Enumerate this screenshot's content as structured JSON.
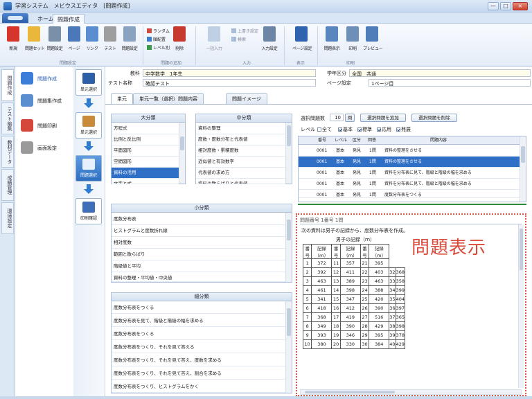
{
  "window": {
    "title": "学習システム　メビウスエディタ　[問題作成]",
    "buttons": [
      "—",
      "□",
      "×"
    ]
  },
  "ribbon": {
    "tabs": [
      "ホーム",
      "問題作成"
    ],
    "active_tab": "問題作成",
    "buttons": [
      {
        "label": "新規",
        "icon": "new-doc-icon",
        "color": "#d6352b"
      },
      {
        "label": "問題セット",
        "icon": "folder-icon",
        "color": "#e8b73c"
      },
      {
        "label": "問題設定",
        "icon": "settings-doc-icon",
        "color": "#7a8fa8"
      },
      {
        "label": "ページ",
        "icon": "page-icon",
        "color": "#4a78b8"
      },
      {
        "label": "リンク",
        "icon": "link-icon",
        "color": "#5a8ed0"
      },
      {
        "label": "テスト",
        "icon": "test-icon",
        "color": "#9e9e9e"
      },
      {
        "label": "問題設定",
        "icon": "settings-icon",
        "color": "#8aa3c0"
      }
    ],
    "random": {
      "label1": "ランダム",
      "label2": "順配置",
      "label3": "レベル別",
      "extra": "削除"
    },
    "center_buttons": [
      "一括入力",
      "全問選択",
      "入力設定",
      "ページ設定",
      "問題表示",
      "印刷",
      "プレビュー"
    ],
    "edit_small": [
      "上書き設定",
      "検索"
    ],
    "groups": [
      "問題設定",
      "問題の追加",
      "入力",
      "表示",
      "印刷"
    ]
  },
  "left_tabs": [
    "問題作成",
    "テスト編集",
    "教材データ",
    "成績管理",
    "環境設定"
  ],
  "nav": [
    {
      "label": "問題作成",
      "icon": "question-create-icon",
      "color": "#3b7dd8",
      "active": true
    },
    {
      "label": "問題集作成",
      "icon": "workbook-icon",
      "color": "#5b8ecf",
      "active": false
    },
    {
      "label": "問題印刷",
      "icon": "print-icon",
      "color": "#d5473a",
      "active": false
    },
    {
      "label": "画面設定",
      "icon": "screen-icon",
      "color": "#9a9a9a",
      "active": false
    }
  ],
  "flow": [
    {
      "label": "単元選択",
      "icon": "unit-icon",
      "active": false
    },
    {
      "label": "単元選択",
      "icon": "person-icon",
      "active": false
    },
    {
      "label": "問題選択",
      "icon": "select-icon",
      "active": true
    },
    {
      "label": "印刷確認",
      "icon": "check-icon",
      "active": false
    }
  ],
  "header": {
    "subject_label": "教科",
    "subject_value": "中学数学　1年生",
    "grade_label": "学年区分",
    "grade_value": "全国　共通",
    "test_label": "テスト名称",
    "test_value": "確認テスト",
    "page_label": "ページ設定",
    "page_value": "1ページ目"
  },
  "tabs": [
    "単元",
    "単元一覧（選択）問題内容",
    "問題イメージ"
  ],
  "big_unit": {
    "title": "大分類",
    "items": [
      "方程式",
      "比例と反比例",
      "平面図形",
      "空間図形",
      "資料の活用",
      "文字と式"
    ],
    "selected": 4
  },
  "mid_unit": {
    "title": "中分類",
    "items": [
      "資料の整理",
      "度数・度数分布と代表値",
      "相対度数・累積度数",
      "近似値と有効数字",
      "代表値の求め方",
      "資料の散らばりと代表値"
    ],
    "selected": -1
  },
  "small_unit": {
    "title": "小分類",
    "items": [
      "度数分布表",
      "ヒストグラムと度数折れ線",
      "相対度数",
      "範囲と散らばり",
      "階級値と平均",
      "資料の整理・平均値・中央値"
    ]
  },
  "detail_unit": {
    "title": "細分類",
    "items": [
      "度数分布表をつくる",
      "度数分布表を見て、階級と階級の幅を求める",
      "度数分布表をつくる",
      "度数分布表をつくり、それを見て答える",
      "度数分布表をつくり、それを見て答え、度数を求める",
      "度数分布表をつくり、それを見て答え、割合を求める",
      "度数分布表をつくり、ヒストグラムをかく"
    ]
  },
  "question_list": {
    "count_label": "選択問題数",
    "count_value": "10",
    "unit": "問",
    "add_button": "選択問題を追加",
    "clear_button": "選択問題を削除",
    "level_label": "レベル",
    "filters": [
      {
        "label": "全て",
        "on": false
      },
      {
        "label": "基本",
        "on": true
      },
      {
        "label": "標準",
        "on": true
      },
      {
        "label": "応用",
        "on": true
      },
      {
        "label": "発展",
        "on": true
      }
    ],
    "columns": [
      "",
      "番号",
      "レベル",
      "区分",
      "回答",
      "問題内容"
    ],
    "rows": [
      {
        "no": "0001",
        "level": "基本",
        "kind": "発見",
        "ans": "1問",
        "text": "資料の整理をさせる",
        "sel": false
      },
      {
        "no": "0001",
        "level": "基本",
        "kind": "発見",
        "ans": "1問",
        "text": "資料の整理をさせる",
        "sel": true
      },
      {
        "no": "0001",
        "level": "基本",
        "kind": "発見",
        "ans": "1問",
        "text": "資料を分布表に見て、階級と階級の幅を求める",
        "sel": false
      },
      {
        "no": "0001",
        "level": "基本",
        "kind": "発見",
        "ans": "1問",
        "text": "資料を分布表に見て、階級と階級の幅を求める",
        "sel": false
      },
      {
        "no": "0001",
        "level": "基本",
        "kind": "発見",
        "ans": "1問",
        "text": "度数分布表をつくる",
        "sel": false
      }
    ]
  },
  "preview": {
    "header_text": "問題番号 1番号 1問",
    "question": "次の資料は男子の記録から、度数分布表を作成。",
    "table_title": "男子の記録（ｍ）",
    "columns": [
      "番号",
      "記録（ｍ）",
      "番号",
      "記録（ｍ）",
      "番号",
      "記録（ｍ）"
    ],
    "rows": [
      [
        "1",
        "372",
        "11",
        "357",
        "21",
        "395"
      ],
      [
        "2",
        "392",
        "12",
        "411",
        "22",
        "403",
        "32",
        "368"
      ],
      [
        "3",
        "463",
        "13",
        "389",
        "23",
        "463",
        "33",
        "358"
      ],
      [
        "4",
        "461",
        "14",
        "398",
        "24",
        "388",
        "34",
        "399"
      ],
      [
        "5",
        "341",
        "15",
        "347",
        "25",
        "420",
        "35",
        "404"
      ],
      [
        "6",
        "418",
        "16",
        "412",
        "26",
        "390",
        "36",
        "397"
      ],
      [
        "7",
        "368",
        "17",
        "419",
        "27",
        "516",
        "37",
        "365"
      ],
      [
        "8",
        "349",
        "18",
        "390",
        "28",
        "429",
        "38",
        "398"
      ],
      [
        "9",
        "393",
        "19",
        "346",
        "29",
        "395",
        "39",
        "378"
      ],
      [
        "10",
        "380",
        "20",
        "330",
        "30",
        "384",
        "40",
        "429"
      ]
    ],
    "overlay_label": "問題表示"
  }
}
